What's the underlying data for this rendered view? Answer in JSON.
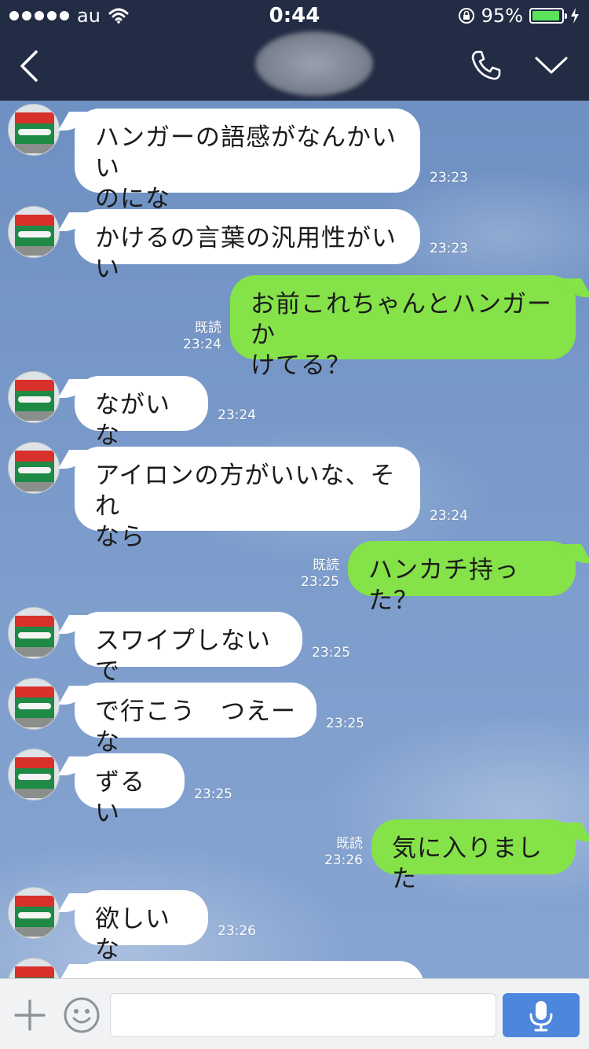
{
  "status_bar": {
    "carrier": "au",
    "time": "0:44",
    "battery_percent": "95%",
    "battery_level": 0.95
  },
  "header": {
    "contact_name_blurred": ""
  },
  "messages": [
    {
      "side": "in",
      "text": "ハンガーの語感がなんかいい\nのにな",
      "time": "23:23"
    },
    {
      "side": "in",
      "text": "かけるの言葉の汎用性がいい",
      "time": "23:23"
    },
    {
      "side": "out",
      "text": "お前これちゃんとハンガーか\nけてる？",
      "time": "23:24",
      "read": "既読"
    },
    {
      "side": "in",
      "text": "ながいな",
      "time": "23:24"
    },
    {
      "side": "in",
      "text": "アイロンの方がいいな、それ\nなら",
      "time": "23:24"
    },
    {
      "side": "out",
      "text": "ハンカチ持った？",
      "time": "23:25",
      "read": "既読"
    },
    {
      "side": "in",
      "text": "スワイプしないで",
      "time": "23:25"
    },
    {
      "side": "in",
      "text": "で行こう　つえーな",
      "time": "23:25"
    },
    {
      "side": "in",
      "text": "ずるい",
      "time": "23:25"
    },
    {
      "side": "out",
      "text": "気に入りました",
      "time": "23:26",
      "read": "既読"
    },
    {
      "side": "in",
      "text": "欲しいな",
      "time": "23:26"
    },
    {
      "side": "in",
      "text": "",
      "time": ""
    }
  ],
  "input": {
    "placeholder": ""
  },
  "icons": {
    "back": "back-arrow-icon",
    "call": "phone-icon",
    "menu": "chevron-down-icon",
    "add": "plus-icon",
    "sticker": "emoji-icon",
    "voice": "microphone-icon",
    "wifi": "wifi-icon",
    "lock": "rotation-lock-icon",
    "charging": "charging-bolt-icon"
  },
  "colors": {
    "header_bg": "#222c44",
    "outgoing_bubble": "#85e249",
    "incoming_bubble": "#ffffff",
    "mic_button": "#4d86dd"
  }
}
